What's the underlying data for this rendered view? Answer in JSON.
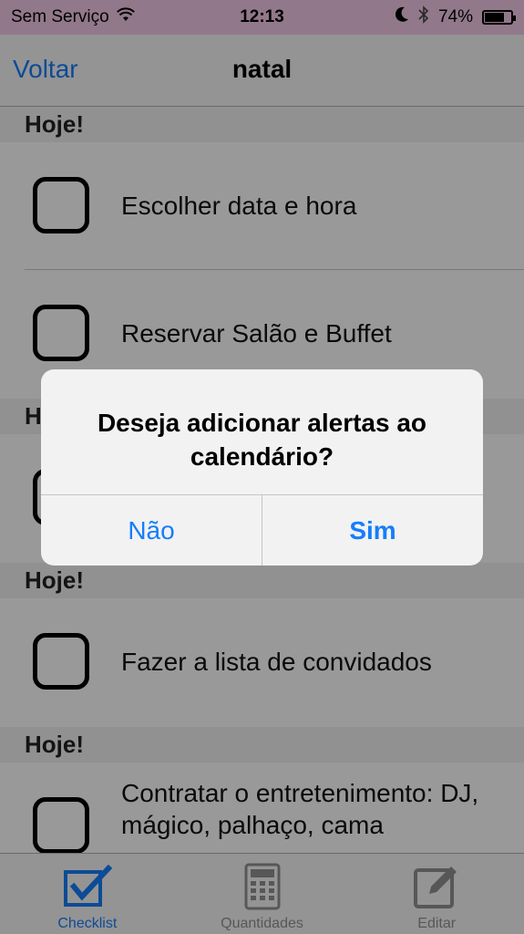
{
  "status_bar": {
    "carrier": "Sem Serviço",
    "time": "12:13",
    "battery_percent": "74%",
    "battery_level": 0.74,
    "icons": [
      "wifi-icon",
      "moon-icon",
      "bluetooth-icon",
      "battery-icon"
    ]
  },
  "nav": {
    "back_label": "Voltar",
    "title": "natal"
  },
  "list": {
    "sections": [
      {
        "header": "Hoje!",
        "items": [
          "Escolher data e hora",
          "Reservar Salão e Buffet"
        ]
      },
      {
        "header": "H",
        "items": [
          ""
        ]
      },
      {
        "header": "Hoje!",
        "items": [
          "Fazer a lista de convidados"
        ]
      },
      {
        "header": "Hoje!",
        "items": [
          "Contratar o entretenimento: DJ, mágico, palhaço, cama"
        ]
      }
    ]
  },
  "alert": {
    "message": "Deseja adicionar alertas ao calendário?",
    "cancel_label": "Não",
    "confirm_label": "Sim"
  },
  "tab_bar": {
    "tabs": [
      {
        "label": "Checklist",
        "icon": "checklist-icon",
        "active": true
      },
      {
        "label": "Quantidades",
        "icon": "calculator-icon",
        "active": false
      },
      {
        "label": "Editar",
        "icon": "edit-icon",
        "active": false
      }
    ]
  },
  "colors": {
    "accent": "#157efb",
    "status_bar_bg": "#f3c9e8",
    "inactive_tab": "#929292"
  }
}
